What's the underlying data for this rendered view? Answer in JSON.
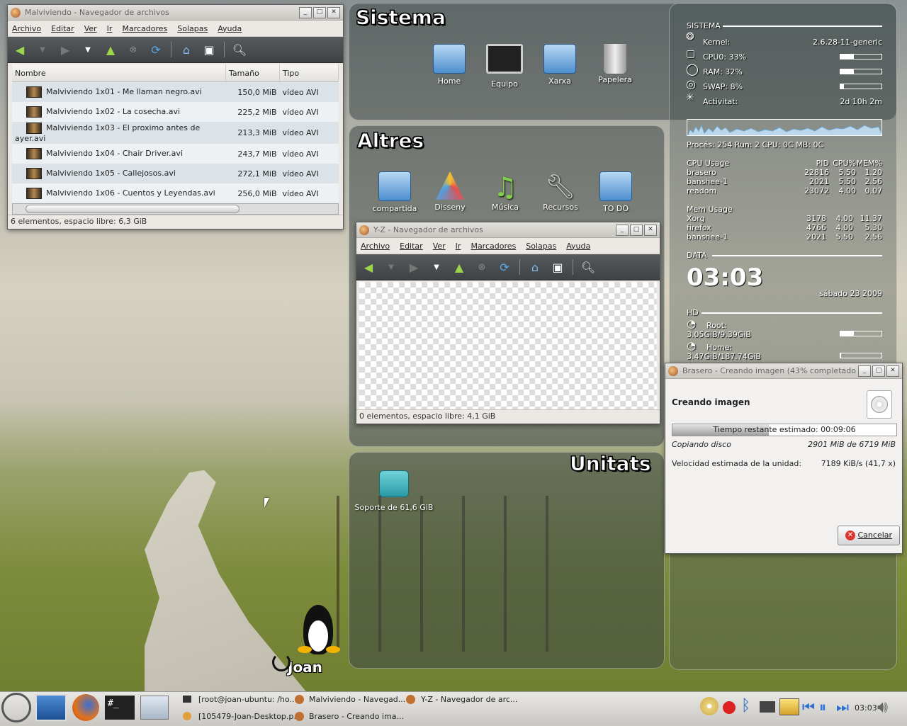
{
  "window1": {
    "title": "Malviviendo - Navegador de archivos",
    "menu": [
      "Archivo",
      "Editar",
      "Ver",
      "Ir",
      "Marcadores",
      "Solapas",
      "Ayuda"
    ],
    "columns": {
      "name": "Nombre",
      "size": "Tamaño",
      "type": "Tipo"
    },
    "files": [
      {
        "name": "Malviviendo 1x01 - Me llaman negro.avi",
        "size": "150,0 MiB",
        "type": "vídeo AVI"
      },
      {
        "name": "Malviviendo 1x02 - La cosecha.avi",
        "size": "225,2 MiB",
        "type": "vídeo AVI"
      },
      {
        "name": "Malviviendo 1x03 - El proximo antes de ayer.avi",
        "size": "213,3 MiB",
        "type": "vídeo AVI"
      },
      {
        "name": "Malviviendo 1x04 - Chair Driver.avi",
        "size": "243,7 MiB",
        "type": "vídeo AVI"
      },
      {
        "name": "Malviviendo 1x05 - Callejosos.avi",
        "size": "272,1 MiB",
        "type": "vídeo AVI"
      },
      {
        "name": "Malviviendo 1x06 - Cuentos y Leyendas.avi",
        "size": "256,0 MiB",
        "type": "vídeo AVI"
      }
    ],
    "status": "6 elementos, espacio libre: 6,3 GiB"
  },
  "window2": {
    "title": "Y-Z - Navegador de archivos",
    "menu": [
      "Archivo",
      "Editar",
      "Ver",
      "Ir",
      "Marcadores",
      "Solapas",
      "Ayuda"
    ],
    "status": "0 elementos, espacio libre: 4,1 GiB"
  },
  "desktop": {
    "sistema": {
      "heading": "Sistema",
      "icons": [
        "Home",
        "Equipo",
        "Xarxa",
        "Papelera"
      ]
    },
    "altres": {
      "heading": "Altres",
      "icons": [
        "compartida",
        "Disseny",
        "Música",
        "Recursos",
        "TO DO"
      ]
    },
    "unitats": {
      "heading": "Unitats",
      "drive": "Soporte de 61,6 GiB"
    },
    "user_logo": "Joan"
  },
  "conky": {
    "sistema_label": "SISTEMA",
    "kernel_label": "Kernel:",
    "kernel": "2.6.28-11-generic",
    "cpu_label": "CPU0: 33%",
    "cpu_pct": 33,
    "ram_label": "RAM: 32%",
    "ram_pct": 32,
    "swap_label": "SWAP: 8%",
    "swap_pct": 8,
    "activity_label": "Activitat:",
    "uptime": "2d 10h 2m",
    "proc_line": "Procés: 254  Run: 2 CPU: 0C MB: 0C",
    "cpu_usage_header": [
      "CPU Usage",
      "PID",
      "CPU%",
      "MEM%"
    ],
    "cpu_procs": [
      [
        "brasero",
        "22816",
        "5.50",
        "1.20"
      ],
      [
        "banshee-1",
        "2021",
        "5.50",
        "2.56"
      ],
      [
        "readom",
        "23072",
        "4.00",
        "0.07"
      ]
    ],
    "mem_usage_header": "Mem Usage",
    "mem_procs": [
      [
        "Xorg",
        "3178",
        "4.00",
        "11.37"
      ],
      [
        "firefox",
        "4766",
        "4.00",
        "5.30"
      ],
      [
        "banshee-1",
        "2021",
        "5.50",
        "2.56"
      ]
    ],
    "data_label": "DATA",
    "time": "03:03",
    "date": "sábado 23 2009",
    "hd_label": "HD",
    "root_label": "Root:",
    "root_usage": "3.05GiB/9.39GiB",
    "root_pct": 32,
    "home_label": "Home:",
    "home_usage": "3.47GiB/187.74GiB",
    "home_pct": 2
  },
  "brasero": {
    "title": "Brasero - Creando imagen (43% completado)",
    "heading": "Creando imagen",
    "progress_text": "Tiempo restante estimado: 00:09:06",
    "progress_pct": 43,
    "copy_label": "Copiando disco",
    "copy_value": "2901 MiB de 6719 MiB",
    "speed_label": "Velocidad estimada de la unidad:",
    "speed_value": "7189 KiB/s (41,7 x)",
    "cancel": "Cancelar"
  },
  "taskbar": {
    "tasks": [
      "[root@joan-ubuntu: /ho...",
      "Malviviendo - Navegad...",
      "Y-Z - Navegador de arc...",
      "[105479-Joan-Desktop.p...",
      "Brasero - Creando ima..."
    ],
    "clock": "03:03"
  }
}
